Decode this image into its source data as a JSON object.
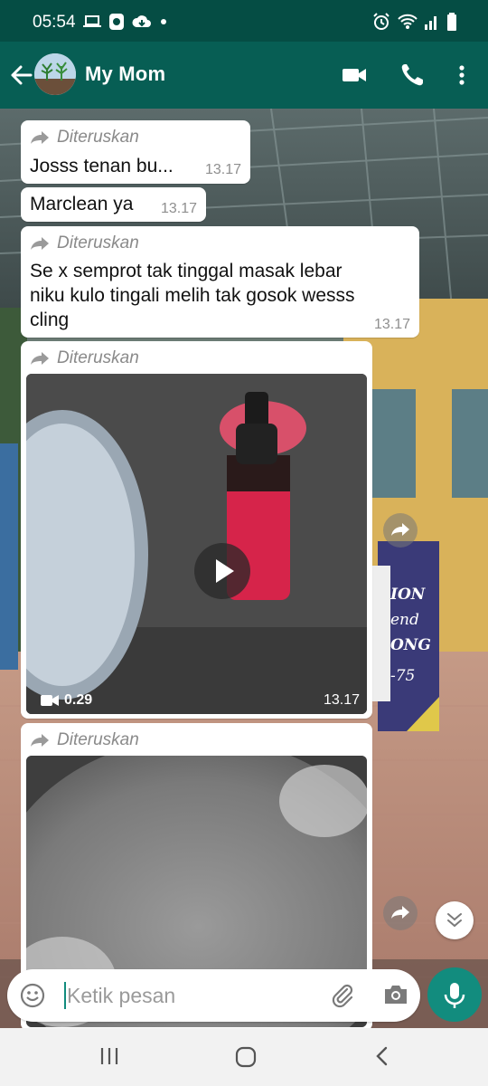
{
  "status_bar": {
    "time": "05:54"
  },
  "header": {
    "contact_name": "My Mom"
  },
  "messages": [
    {
      "forwarded_label": "Diteruskan",
      "text": "Josss tenan bu...",
      "time": "13.17"
    },
    {
      "text": "Marclean ya",
      "time": "13.17"
    },
    {
      "forwarded_label": "Diteruskan",
      "text_lines": [
        "Se x semprot tak tinggal masak lebar",
        "niku kulo tingali melih tak gosok wesss",
        "cling"
      ],
      "time": "13.17"
    },
    {
      "forwarded_label": "Diteruskan",
      "type": "video",
      "duration": "0.29",
      "time": "13.17"
    },
    {
      "forwarded_label": "Diteruskan",
      "type": "image"
    }
  ],
  "composer": {
    "placeholder": "Ketik pesan"
  },
  "colors": {
    "header": "#075e54",
    "status_bar": "#054d44",
    "accent": "#128c7e"
  },
  "icons": [
    "back-arrow-icon",
    "video-call-icon",
    "phone-icon",
    "more-vert-icon",
    "forward-icon",
    "play-icon",
    "video-camera-icon",
    "emoji-icon",
    "attach-icon",
    "camera-icon",
    "mic-icon",
    "double-chevron-down-icon"
  ]
}
